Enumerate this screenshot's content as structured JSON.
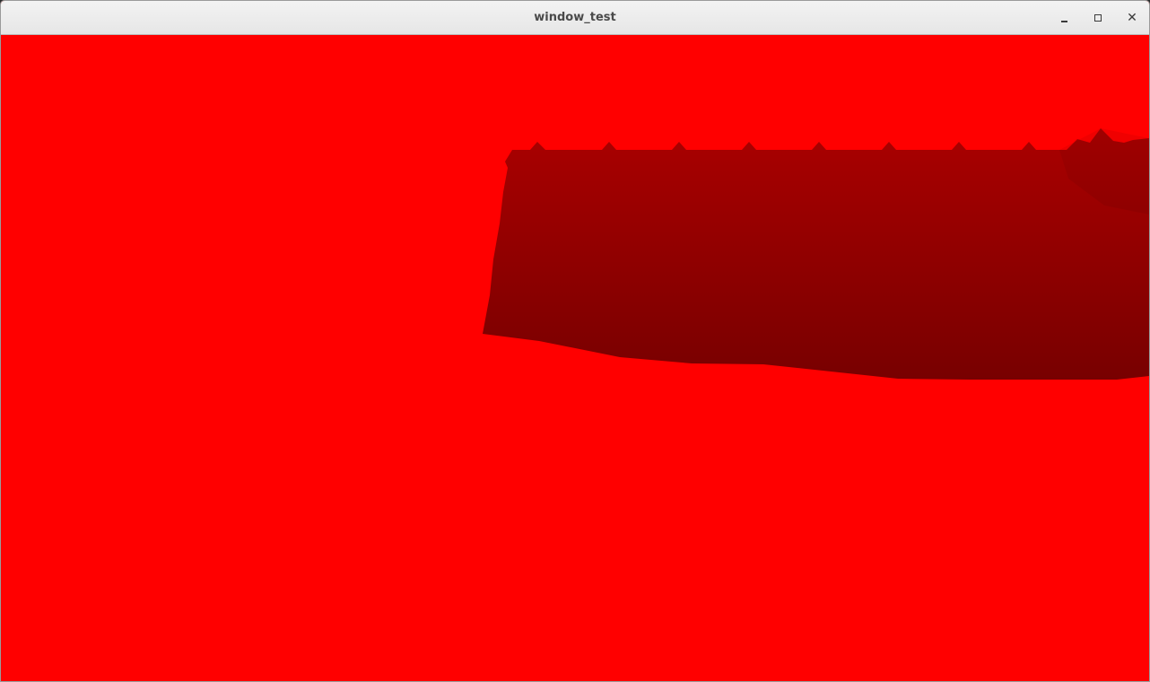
{
  "window": {
    "title": "window_test",
    "controls": {
      "minimize": "minimize-icon",
      "maximize": "maximize-icon",
      "close": "close-icon"
    }
  },
  "scene": {
    "background_color": "#ff0000",
    "shape_color_top": "#aa0000",
    "shape_color_bottom": "#780000"
  }
}
